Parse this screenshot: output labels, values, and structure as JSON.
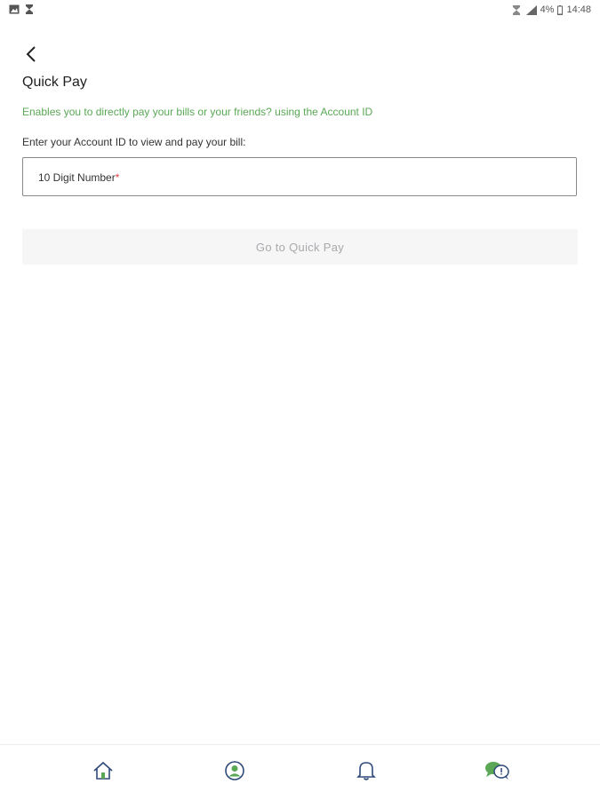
{
  "status_bar": {
    "left_icons": [
      "image-icon",
      "hourglass-icon"
    ],
    "right_icons": [
      "alarm-icon",
      "signal-icon"
    ],
    "battery_text": "4%",
    "time": "14:48"
  },
  "header": {
    "back_icon": "chevron-left-icon",
    "title": "Quick Pay"
  },
  "main": {
    "subtitle": "Enables you to directly pay your bills or your friends? using the Account ID",
    "field_label": "Enter your Account ID to view and pay your bill:",
    "input": {
      "placeholder": "10 Digit Number",
      "required_mark": "*",
      "value": ""
    },
    "button_label": "Go to Quick Pay"
  },
  "bottom_nav": {
    "items": [
      {
        "icon": "home-icon"
      },
      {
        "icon": "profile-icon"
      },
      {
        "icon": "bell-icon"
      },
      {
        "icon": "chat-support-icon"
      }
    ]
  },
  "colors": {
    "accent_green": "#5aa856",
    "nav_icon": "#2e4a7a",
    "required": "#e04040",
    "button_disabled_bg": "#f6f6f7",
    "button_disabled_text": "#a9a9ad"
  }
}
